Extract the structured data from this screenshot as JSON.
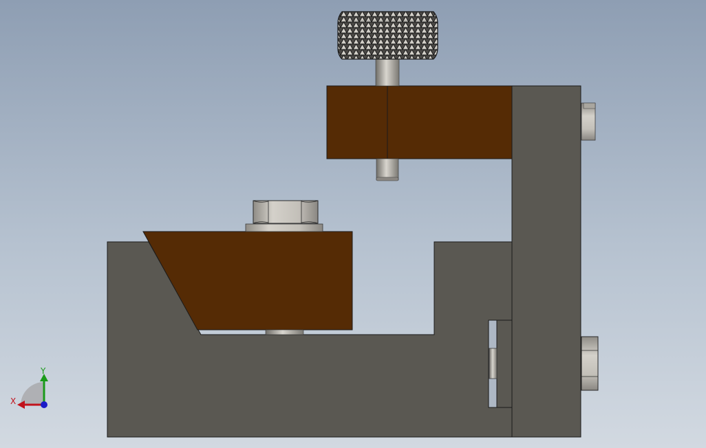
{
  "viewport": {
    "background_top": "#8e9eb3",
    "background_bottom": "#d2d9e1"
  },
  "colors": {
    "steel_body": "#5a5852",
    "steel_edge": "#1a1a1a",
    "wood_jaw": "#552b05",
    "metal_light": "#c9c6bf",
    "metal_mid": "#9c9992",
    "metal_dark": "#6f6d68"
  },
  "triad": {
    "x_label": "X",
    "y_label": "Y",
    "x_color": "#c1121c",
    "y_color": "#1a9a1a",
    "z_color": "#1c1cc8"
  },
  "icons": [
    "knurled-knob-icon",
    "hex-nut-icon",
    "coordinate-triad-icon"
  ]
}
